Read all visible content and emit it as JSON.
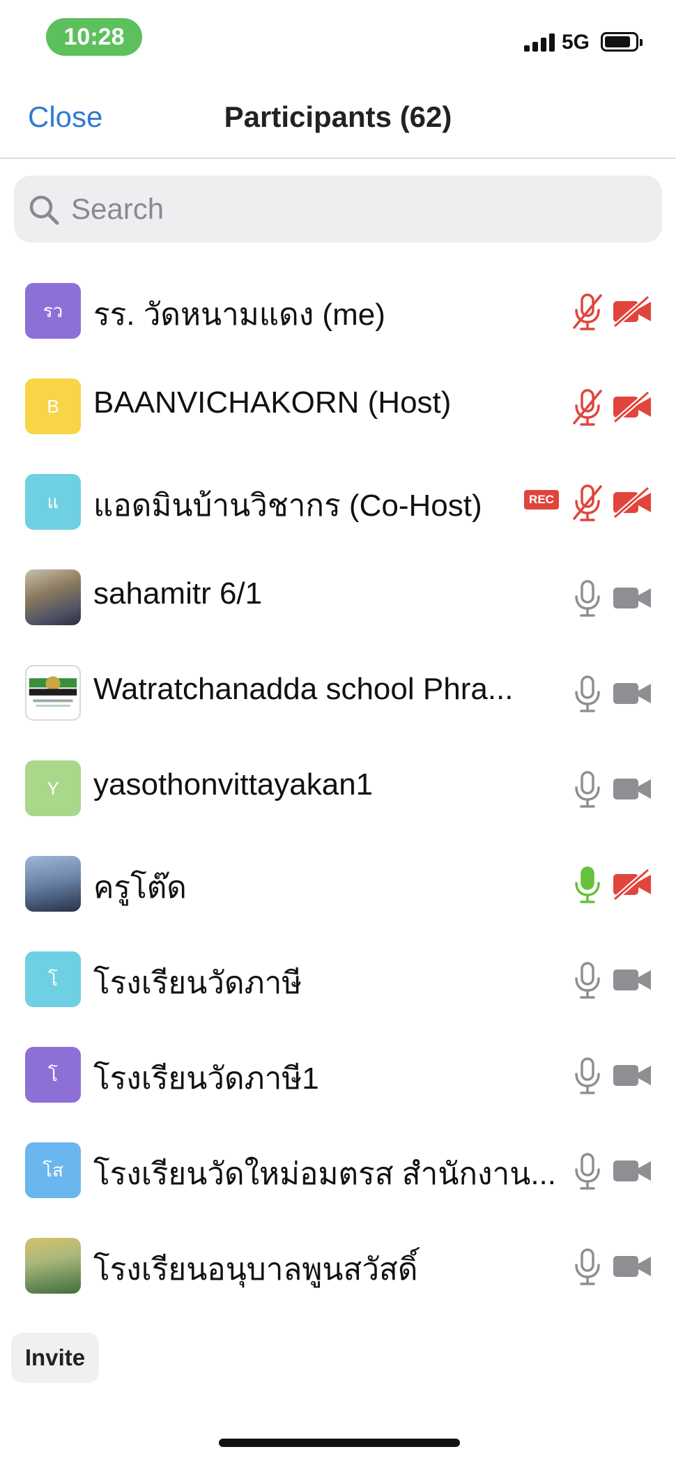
{
  "status_bar": {
    "time": "10:28",
    "network": "5G"
  },
  "header": {
    "close_label": "Close",
    "title": "Participants (62)"
  },
  "search": {
    "placeholder": "Search",
    "value": ""
  },
  "participants": [
    {
      "avatar_text": "รว",
      "avatar_color": "#8e6fd6",
      "name": "รร. วัดหนามแดง (me)",
      "mic": "muted",
      "video": "off"
    },
    {
      "avatar_text": "B",
      "avatar_color": "#f7d546",
      "name": "BAANVICHAKORN (Host)",
      "mic": "muted",
      "video": "off"
    },
    {
      "avatar_text": "แ",
      "avatar_color": "#6fd0e4",
      "name": "แอดมินบ้านวิชากร (Co-Host)",
      "badge": "REC",
      "mic": "muted",
      "video": "off"
    },
    {
      "avatar_text": "",
      "avatar_color": "",
      "name": "sahamitr 6/1",
      "mic": "on",
      "video": "on"
    },
    {
      "avatar_text": "",
      "avatar_color": "",
      "name": "Watratchanadda school Phra...",
      "mic": "on",
      "video": "on"
    },
    {
      "avatar_text": "Y",
      "avatar_color": "#a9d88a",
      "name": "yasothonvittayakan1",
      "mic": "on",
      "video": "on"
    },
    {
      "avatar_text": "",
      "avatar_color": "",
      "name": "ครูโต๊ด",
      "mic": "speaking",
      "video": "off"
    },
    {
      "avatar_text": "โ",
      "avatar_color": "#6fd0e4",
      "name": "โรงเรียนวัดภาษี",
      "mic": "on",
      "video": "on"
    },
    {
      "avatar_text": "โ",
      "avatar_color": "#8e6fd6",
      "name": "โรงเรียนวัดภาษี1",
      "mic": "on",
      "video": "on"
    },
    {
      "avatar_text": "โส",
      "avatar_color": "#6ab6ee",
      "name": "โรงเรียนวัดใหม่อมตรส สำนักงาน...",
      "mic": "on",
      "video": "on"
    },
    {
      "avatar_text": "",
      "avatar_color": "",
      "name": "โรงเรียนอนุบาลพูนสวัสดิ์",
      "mic": "on",
      "video": "on"
    }
  ],
  "invite_label": "Invite",
  "colors": {
    "accent": "#2f7bd1",
    "muted_red": "#e0453d",
    "icon_gray": "#8e8e93",
    "speaking_green": "#65c23a"
  }
}
